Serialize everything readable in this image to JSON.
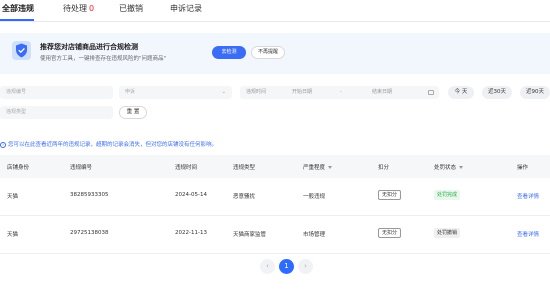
{
  "tabs": [
    {
      "label": "全部违规",
      "count": ""
    },
    {
      "label": "待处理",
      "count": "0"
    },
    {
      "label": "已撤销",
      "count": ""
    },
    {
      "label": "申诉记录",
      "count": ""
    }
  ],
  "banner": {
    "title": "推荐您对店铺商品进行合规检测",
    "subtitle": "使用官方工具，一键排查存在违规风险的\"问题商品\"",
    "primary_button": "去检测",
    "secondary_button": "不再提醒"
  },
  "filters": {
    "violation_no_placeholder": "违规编号",
    "penalty_placeholder": "申诉",
    "violation_time_label": "违规时间",
    "start_date_placeholder": "开始日期",
    "date_separator": "-",
    "end_date_placeholder": "结束日期",
    "quick_today": "今 天",
    "quick_30": "近30天",
    "quick_90": "近90天",
    "violation_type_placeholder": "违规类型",
    "reset_button": "重 置"
  },
  "notice": "您可以在此查看近两年的违规记录，超期的记录会消失，但对您的店铺没有任何影响。",
  "table": {
    "headers": [
      "店铺身份",
      "违规编号",
      "违规时间",
      "违规类型",
      "严重程度",
      "扣分",
      "处罚状态",
      "操作"
    ],
    "rows": [
      {
        "shop": "天猫",
        "id": "38285933305",
        "time": "2024-05-14",
        "type": "恶意骚扰",
        "severity": "一般违规",
        "deduct": "无扣分",
        "status": "处罚完成",
        "status_color": "#2ba84a",
        "action": "查看详情"
      },
      {
        "shop": "天猫",
        "id": "29725138038",
        "time": "2022-11-13",
        "type": "天猫商家监管",
        "severity": "市场管理",
        "deduct": "无扣分",
        "status": "处罚撤销",
        "status_color": "#333333",
        "action": "查看详情"
      }
    ]
  },
  "pagination": {
    "prev": "‹",
    "current": "1",
    "next": "›"
  },
  "colors": {
    "accent": "#2f6bff",
    "danger": "#f5222d",
    "success": "#2ba84a"
  }
}
